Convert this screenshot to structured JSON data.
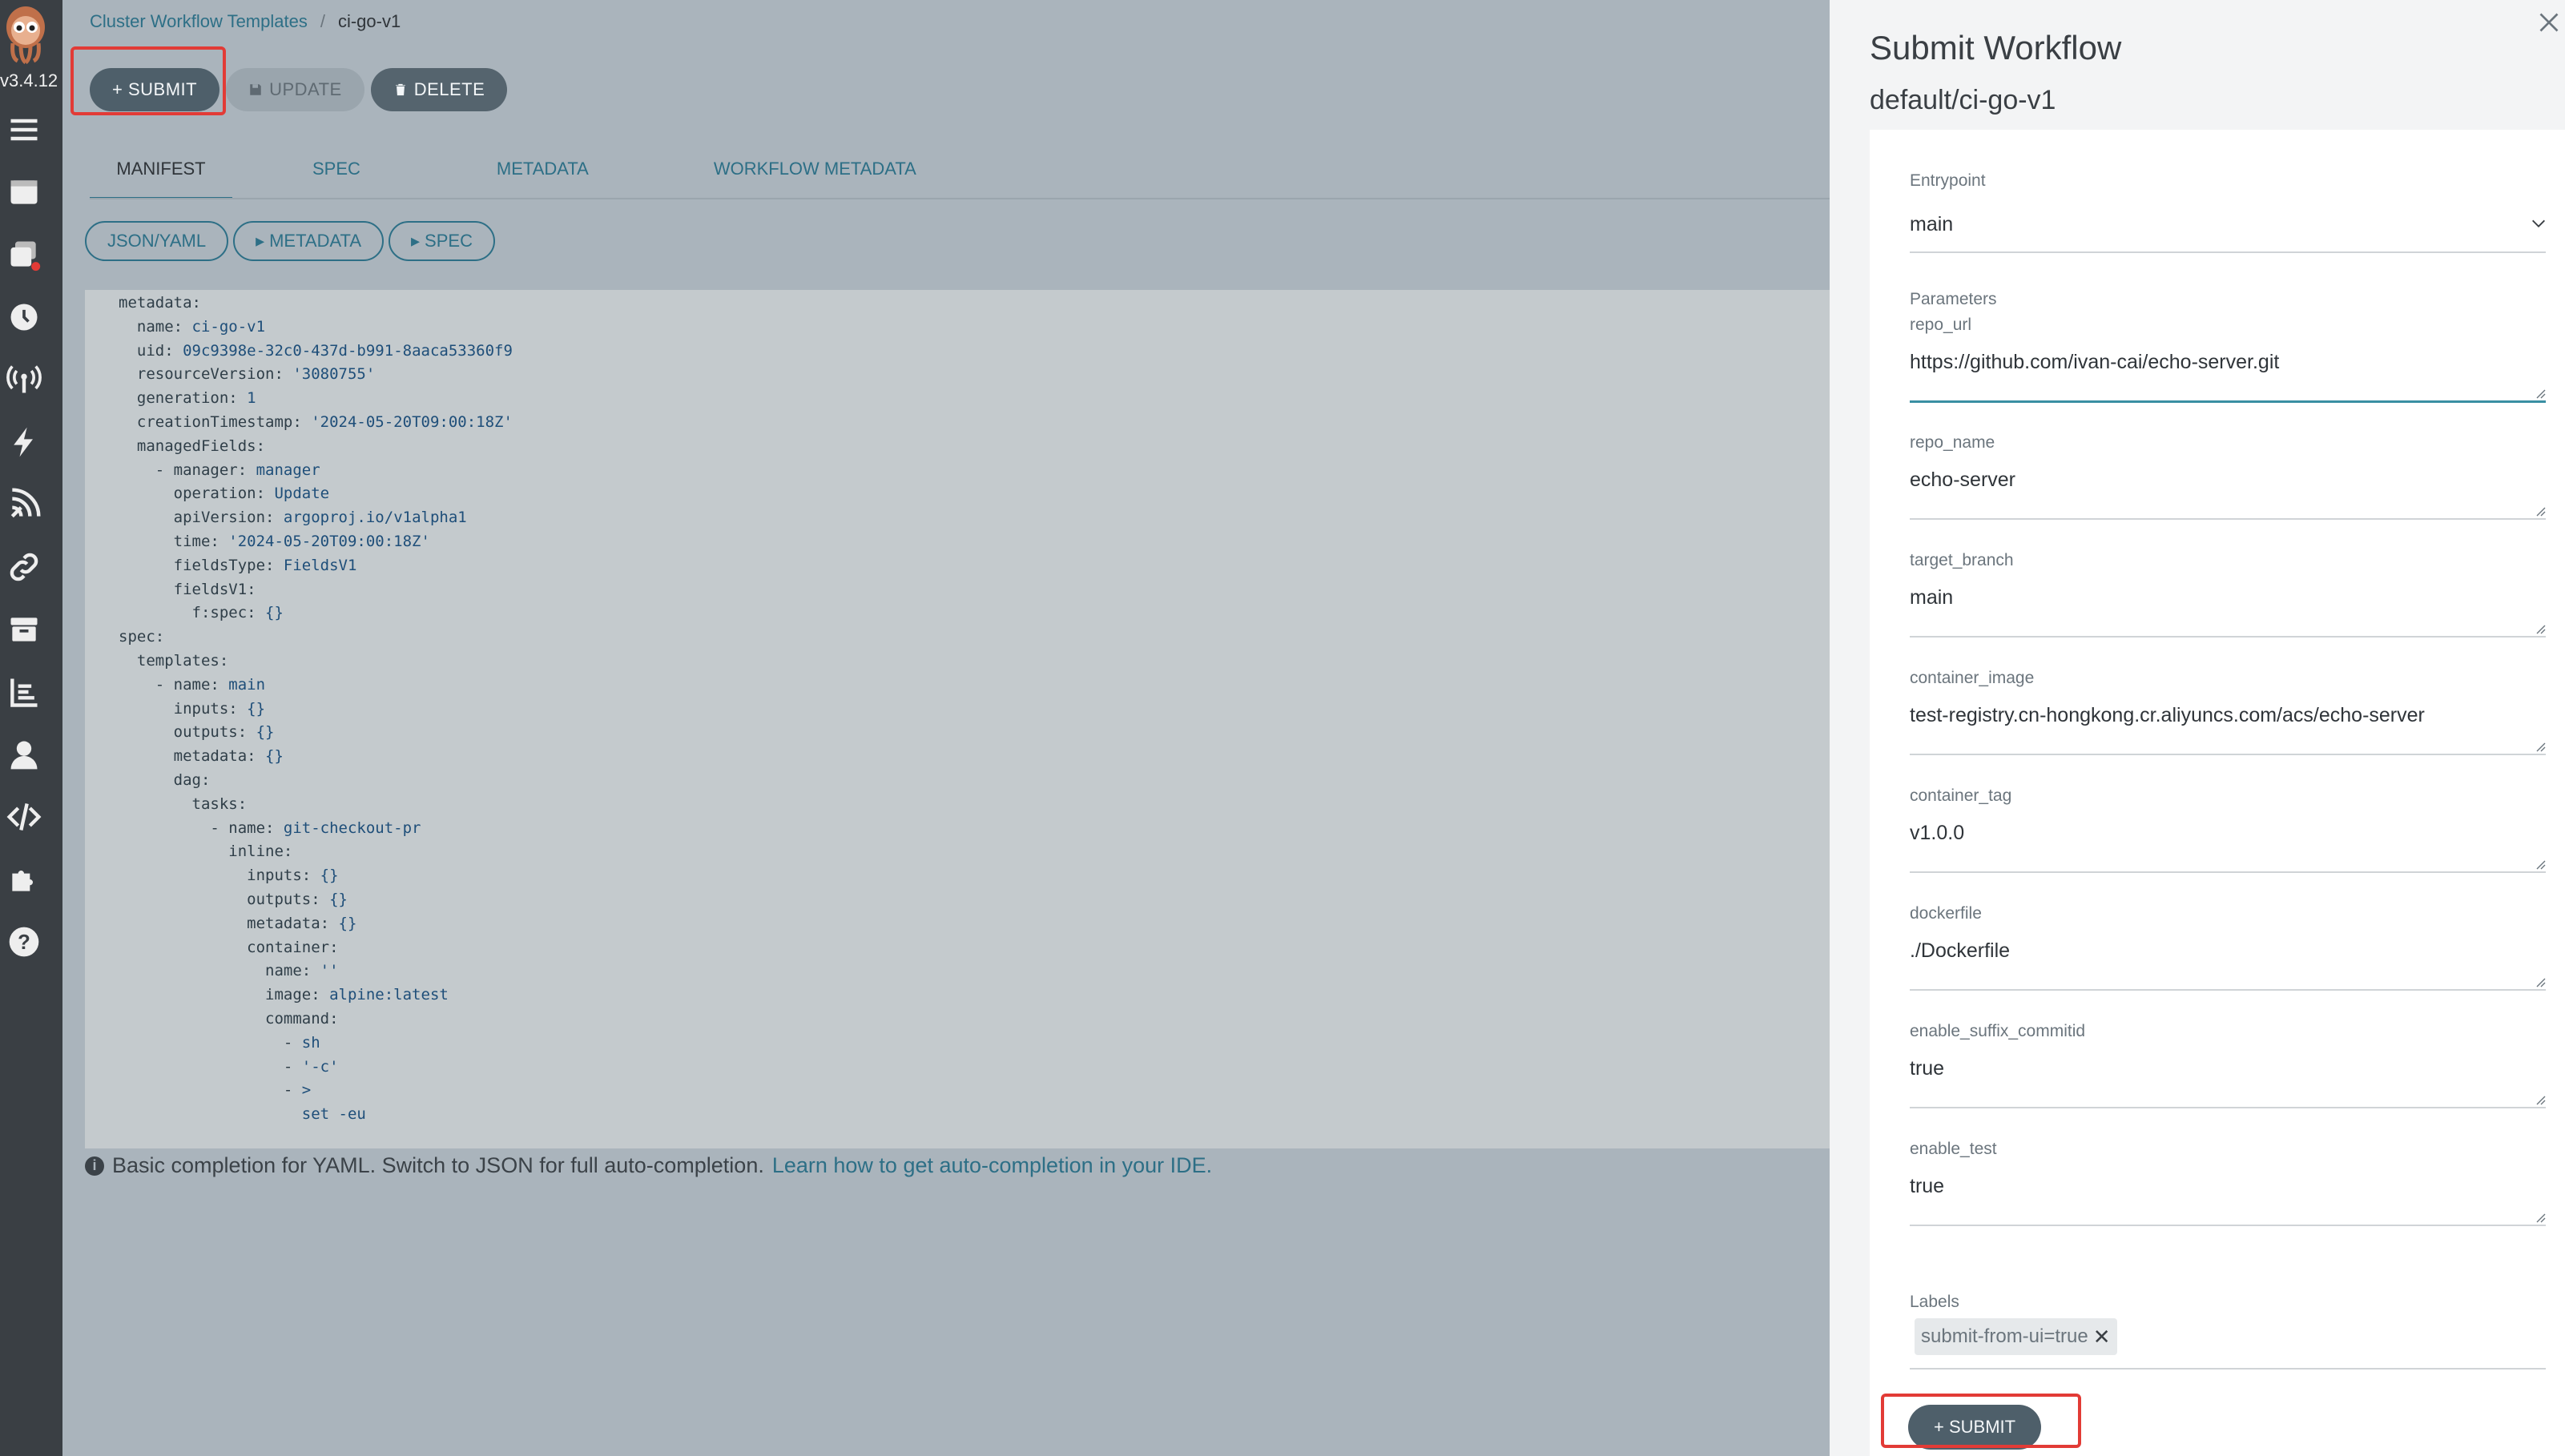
{
  "sidebar": {
    "version": "v3.4.12",
    "icons": [
      "menu-icon",
      "workflow-templates-icon",
      "cluster-templates-icon",
      "cron-clock-icon",
      "event-sources-icon",
      "sensors-lightning-icon",
      "event-flow-icon",
      "links-icon",
      "archive-icon",
      "reports-icon",
      "user-icon",
      "api-docs-icon",
      "plugins-icon",
      "help-icon"
    ]
  },
  "breadcrumb": {
    "parent": "Cluster Workflow Templates",
    "separator": "/",
    "current": "ci-go-v1"
  },
  "toolbar": {
    "submit": "+ SUBMIT",
    "update": "UPDATE",
    "delete": "DELETE"
  },
  "tabs": [
    "MANIFEST",
    "SPEC",
    "METADATA",
    "WORKFLOW METADATA"
  ],
  "editor_tabs": {
    "json_yaml": "JSON/YAML",
    "metadata": "METADATA",
    "spec": "SPEC"
  },
  "code_lines": [
    {
      "indent": "",
      "key": "metadata:",
      "value": ""
    },
    {
      "indent": "  ",
      "key": "name: ",
      "value": "ci-go-v1"
    },
    {
      "indent": "  ",
      "key": "uid: ",
      "value": "09c9398e-32c0-437d-b991-8aaca53360f9"
    },
    {
      "indent": "  ",
      "key": "resourceVersion: ",
      "value": "'3080755'"
    },
    {
      "indent": "  ",
      "key": "generation: ",
      "value": "1"
    },
    {
      "indent": "  ",
      "key": "creationTimestamp: ",
      "value": "'2024-05-20T09:00:18Z'"
    },
    {
      "indent": "  ",
      "key": "managedFields:",
      "value": ""
    },
    {
      "indent": "    ",
      "key": "- manager: ",
      "value": "manager"
    },
    {
      "indent": "      ",
      "key": "operation: ",
      "value": "Update"
    },
    {
      "indent": "      ",
      "key": "apiVersion: ",
      "value": "argoproj.io/v1alpha1"
    },
    {
      "indent": "      ",
      "key": "time: ",
      "value": "'2024-05-20T09:00:18Z'"
    },
    {
      "indent": "      ",
      "key": "fieldsType: ",
      "value": "FieldsV1"
    },
    {
      "indent": "      ",
      "key": "fieldsV1:",
      "value": ""
    },
    {
      "indent": "        ",
      "key": "f:spec: ",
      "value": "{}"
    },
    {
      "indent": "",
      "key": "spec:",
      "value": ""
    },
    {
      "indent": "  ",
      "key": "templates:",
      "value": ""
    },
    {
      "indent": "    ",
      "key": "- name: ",
      "value": "main"
    },
    {
      "indent": "      ",
      "key": "inputs: ",
      "value": "{}"
    },
    {
      "indent": "      ",
      "key": "outputs: ",
      "value": "{}"
    },
    {
      "indent": "      ",
      "key": "metadata: ",
      "value": "{}"
    },
    {
      "indent": "      ",
      "key": "dag:",
      "value": ""
    },
    {
      "indent": "        ",
      "key": "tasks:",
      "value": ""
    },
    {
      "indent": "          ",
      "key": "- name: ",
      "value": "git-checkout-pr"
    },
    {
      "indent": "            ",
      "key": "inline:",
      "value": ""
    },
    {
      "indent": "              ",
      "key": "inputs: ",
      "value": "{}"
    },
    {
      "indent": "              ",
      "key": "outputs: ",
      "value": "{}"
    },
    {
      "indent": "              ",
      "key": "metadata: ",
      "value": "{}"
    },
    {
      "indent": "              ",
      "key": "container:",
      "value": ""
    },
    {
      "indent": "                ",
      "key": "name: ",
      "value": "''"
    },
    {
      "indent": "                ",
      "key": "image: ",
      "value": "alpine:latest"
    },
    {
      "indent": "                ",
      "key": "command:",
      "value": ""
    },
    {
      "indent": "                  ",
      "key": "- ",
      "value": "sh"
    },
    {
      "indent": "                  ",
      "key": "- ",
      "value": "'-c'"
    },
    {
      "indent": "                  ",
      "key": "- ",
      "value": ">"
    },
    {
      "indent": "                    ",
      "key": "",
      "value": "set -eu"
    }
  ],
  "hint": {
    "text": "Basic completion for YAML. Switch to JSON for full auto-completion.",
    "link": "Learn how to get auto-completion in your IDE."
  },
  "panel": {
    "title": "Submit Workflow",
    "subtitle": "default/ci-go-v1",
    "entrypoint_label": "Entrypoint",
    "entrypoint_value": "main",
    "parameters_label": "Parameters",
    "params": [
      {
        "name": "repo_url",
        "value": "https://github.com/ivan-cai/echo-server.git"
      },
      {
        "name": "repo_name",
        "value": "echo-server"
      },
      {
        "name": "target_branch",
        "value": "main"
      },
      {
        "name": "container_image",
        "value": "test-registry.cn-hongkong.cr.aliyuncs.com/acs/echo-server"
      },
      {
        "name": "container_tag",
        "value": "v1.0.0"
      },
      {
        "name": "dockerfile",
        "value": "./Dockerfile"
      },
      {
        "name": "enable_suffix_commitid",
        "value": "true"
      },
      {
        "name": "enable_test",
        "value": "true"
      }
    ],
    "labels_label": "Labels",
    "label_chip": "submit-from-ui=true",
    "submit": "+ SUBMIT"
  },
  "colors": {
    "highlight": "#e23b36",
    "accent": "#2d6f86",
    "button_dark": "#4e5f6a"
  }
}
